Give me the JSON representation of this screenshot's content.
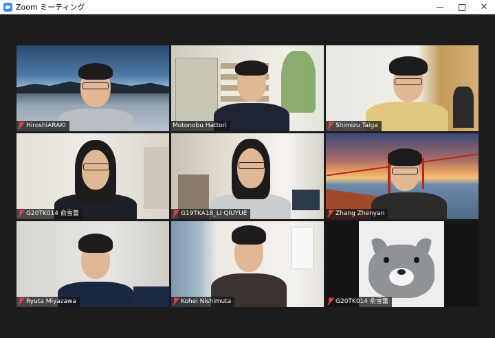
{
  "window": {
    "title": "Zoom ミーティング",
    "controls": {
      "minimize": "",
      "maximize": "",
      "close": "✕"
    }
  },
  "participants": [
    {
      "name": "HiroshiARAKI",
      "muted": true,
      "active_speaker": false
    },
    {
      "name": "Motonobu Hattori",
      "muted": false,
      "active_speaker": true
    },
    {
      "name": "Shimizu Taiga",
      "muted": true,
      "active_speaker": false
    },
    {
      "name": "G20TK014 俞雪蕾",
      "muted": true,
      "active_speaker": false
    },
    {
      "name": "G19TKA18_LI QIUYUE",
      "muted": true,
      "active_speaker": false
    },
    {
      "name": "Zhang Zhenyan",
      "muted": true,
      "active_speaker": false
    },
    {
      "name": "Ryuta Miyazawa",
      "muted": true,
      "active_speaker": false
    },
    {
      "name": "Kohei Nishimuta",
      "muted": true,
      "active_speaker": false
    },
    {
      "name": "G20TK014 俞雪蕾",
      "muted": true,
      "active_speaker": false
    }
  ],
  "colors": {
    "active_speaker_border": "#d3e84a",
    "muted_icon": "#e34040",
    "background": "#1c1c1c",
    "zoom_blue": "#2d8cff"
  }
}
